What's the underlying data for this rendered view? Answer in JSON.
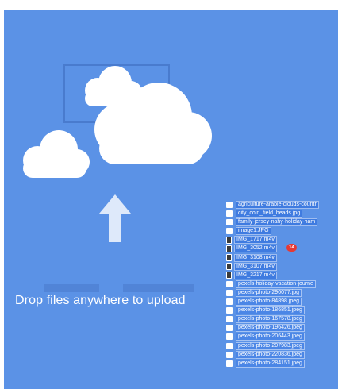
{
  "overlay": {
    "message": "Drop files anywhere to upload",
    "background_color": "#5b92e6",
    "icons": [
      "cloud-icon",
      "upload-arrow-icon"
    ]
  },
  "drag_stack": {
    "count_badge": "14",
    "badge_color": "#e53935",
    "files": [
      {
        "name": "agriculture-arable-clouds-countr",
        "icon": "image-file-icon"
      },
      {
        "name": "city_coin_field_heads.jpg",
        "icon": "image-file-icon"
      },
      {
        "name": "family-jersey-nahy-holiday-ham",
        "icon": "image-file-icon"
      },
      {
        "name": "image1.JPG",
        "icon": "image-file-icon"
      },
      {
        "name": "IMG_1717.m4v",
        "icon": "video-file-icon"
      },
      {
        "name": "IMG_3052.m4v",
        "icon": "video-file-icon"
      },
      {
        "name": "IMG_3108.m4v",
        "icon": "video-file-icon"
      },
      {
        "name": "IMG_3107.m4v",
        "icon": "video-file-icon"
      },
      {
        "name": "IMG_3217.m4v",
        "icon": "video-file-icon"
      },
      {
        "name": "pexels-holiday-vacation-journe",
        "icon": "image-file-icon"
      },
      {
        "name": "pexels-photo-290077.jpg",
        "icon": "image-file-icon"
      },
      {
        "name": "pexels-photo-84898.jpeg",
        "icon": "image-file-icon"
      },
      {
        "name": "pexels-photo-186851.jpeg",
        "icon": "image-file-icon"
      },
      {
        "name": "pexels-photo-167578.jpeg",
        "icon": "image-file-icon"
      },
      {
        "name": "pexels-photo-196426.jpeg",
        "icon": "image-file-icon"
      },
      {
        "name": "pexels-photo-206443.jpeg",
        "icon": "image-file-icon"
      },
      {
        "name": "pexels-photo-207983.jpeg",
        "icon": "image-file-icon"
      },
      {
        "name": "pexels-photo-220836.jpeg",
        "icon": "image-file-icon"
      },
      {
        "name": "pexels-photo-284151.jpeg",
        "icon": "image-file-icon"
      }
    ]
  }
}
